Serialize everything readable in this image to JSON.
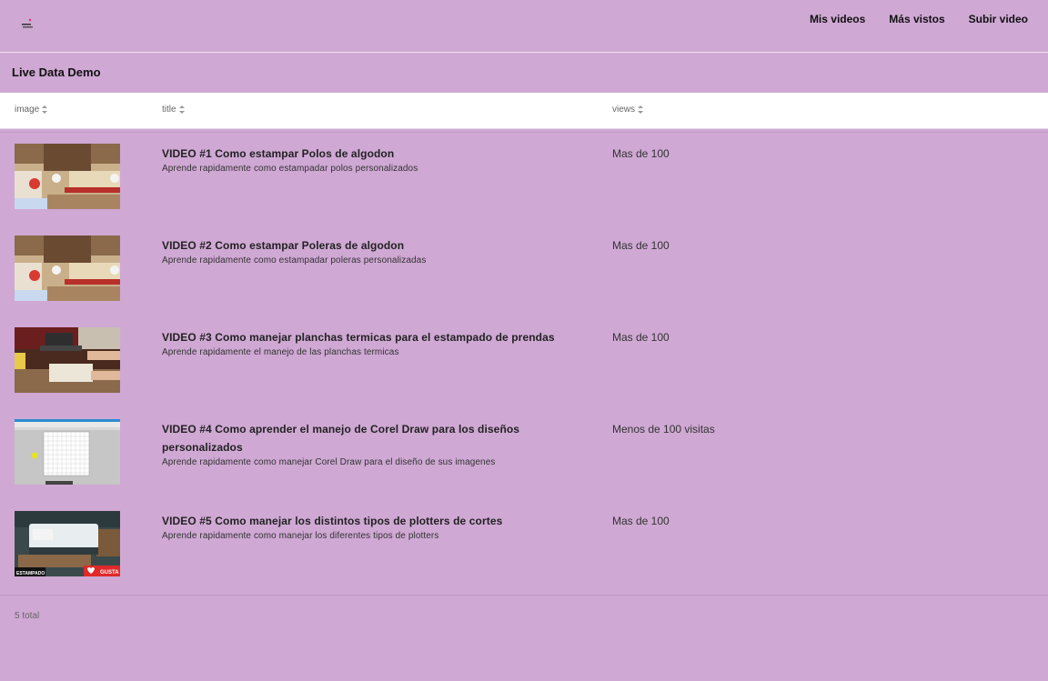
{
  "nav": {
    "links": [
      "Mis videos",
      "Más vistos",
      "Subir video"
    ]
  },
  "page": {
    "title": "Live Data Demo"
  },
  "table": {
    "columns": [
      "image",
      "title",
      "views"
    ],
    "rows": [
      {
        "title": "VIDEO #1 Como estampar Polos de algodon",
        "description": "Aprende rapidamente como estampadar polos personalizados",
        "views": "Mas de 100",
        "thumbnail": "screen-printing"
      },
      {
        "title": "VIDEO #2 Como estampar Poleras de algodon",
        "description": "Aprende rapidamente como estampadar poleras personalizadas",
        "views": "Mas de 100",
        "thumbnail": "screen-printing"
      },
      {
        "title": "VIDEO #3 Como manejar planchas termicas para el estampado de prendas",
        "description": "Aprende rapidamente el manejo de las planchas termicas",
        "views": "Mas de 100",
        "thumbnail": "heat-press"
      },
      {
        "title": "VIDEO #4 Como aprender el manejo de Corel Draw para los diseños personalizados",
        "description": "Aprende rapidamente como manejar Corel Draw para el diseño de sus imagenes",
        "views": "Menos de 100 visitas",
        "thumbnail": "corel-draw"
      },
      {
        "title": "VIDEO #5 Como manejar los distintos tipos de plotters de cortes",
        "description": "Aprende rapidamente como manejar los diferentes tipos de plotters",
        "views": "Mas de 100",
        "thumbnail": "plotter"
      }
    ],
    "thumb_overlay_5": {
      "left_text": "ESTAMPADO",
      "right_text": "GUSTA"
    }
  },
  "footer": {
    "total": "5 total"
  },
  "colors": {
    "background": "#cfa8d4",
    "header_bg": "#ffffff"
  }
}
